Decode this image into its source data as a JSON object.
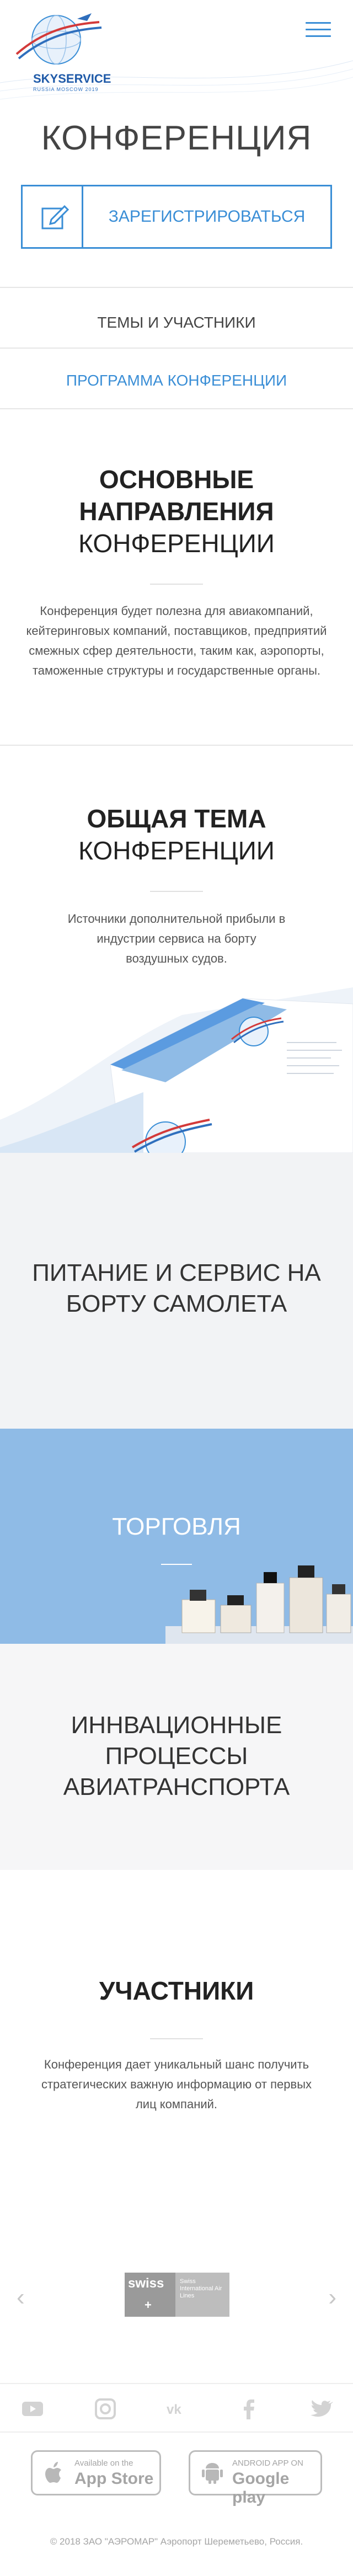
{
  "brand": {
    "logo_text": "SKYSERVICE",
    "logo_sub": "RUSSIA MOSCOW 2019"
  },
  "header": {
    "menu_icon": "hamburger-menu-icon"
  },
  "page_title": "КОНФЕРЕНЦИЯ",
  "register_button": {
    "label": "ЗАРЕГИСТРИРОВАТЬСЯ",
    "icon": "edit-icon"
  },
  "nav": [
    {
      "label": "ТЕМЫ И УЧАСТНИКИ"
    },
    {
      "label": "ПРОГРАММА КОНФЕРЕНЦИИ"
    }
  ],
  "section_directions": {
    "title_bold": "ОСНОВНЫЕ НАПРАВЛЕНИЯ",
    "title_light": "КОНФЕРЕНЦИИ",
    "text": "Конференция будет полезна для авиакомпаний, кейтеринговых компаний, поставщиков, предприятий смежных сфер деятельности, таким как, аэропорты, таможенные структуры и государственные органы."
  },
  "section_topic": {
    "title_bold": "ОБЩАЯ ТЕМА",
    "title_light": "КОНФЕРЕНЦИИ",
    "text": "Источники дополнительной прибыли в индустрии сервиса на борту воздушных судов."
  },
  "tiles": [
    {
      "title": "ПИТАНИЕ И СЕРВИС НА БОРТУ САМОЛЕТА"
    },
    {
      "title": "ТОРГОВЛЯ"
    },
    {
      "title": "ИННВАЦИОННЫЕ ПРОЦЕССЫ АВИАТРАНСПОРТА"
    }
  ],
  "participants": {
    "title": "УЧАСТНИКИ",
    "text": "Конференция дает уникальный шанс получить стратегических важную информацию от первых лиц компаний.",
    "partner_logo_text": "swiss",
    "partner_caption": "Swiss International Air Lines"
  },
  "social": [
    "youtube-icon",
    "instagram-icon",
    "vk-icon",
    "facebook-icon",
    "twitter-icon"
  ],
  "stores": {
    "appstore_small": "Available on the",
    "appstore_large": "App Store",
    "googleplay_small": "ANDROID APP ON",
    "googleplay_large": "Google play"
  },
  "footer": "© 2018 ЗАО \"АЭРОМАР\" Аэропорт Шереметьево, Россия.",
  "colors": {
    "accent": "#3a8ed6",
    "tile_blue": "#8fbbe6",
    "tile_grey": "#f2f3f5"
  }
}
